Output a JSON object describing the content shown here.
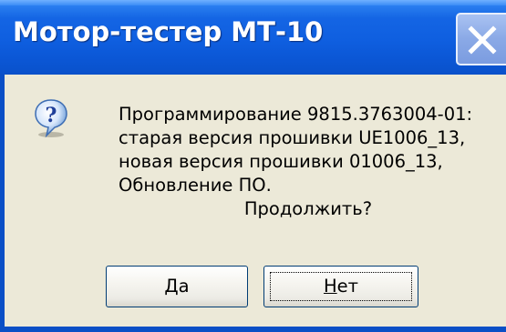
{
  "window": {
    "title": "Мотор-тестер МТ-10",
    "close_icon": "close-icon"
  },
  "dialog": {
    "icon": "question-icon",
    "message_lines": [
      "Программирование 9815.3763004-01:",
      "старая версия прошивки UE1006_13,",
      "новая версия прошивки 01006_13,",
      "Обновление ПО."
    ],
    "prompt": "Продолжить?"
  },
  "buttons": {
    "yes": {
      "accel": "Д",
      "rest": "а"
    },
    "no": {
      "accel": "Н",
      "rest": "ет"
    }
  },
  "colors": {
    "titlebar": "#0f5fe0",
    "background": "#ece9d8",
    "button_border": "#003c74"
  }
}
